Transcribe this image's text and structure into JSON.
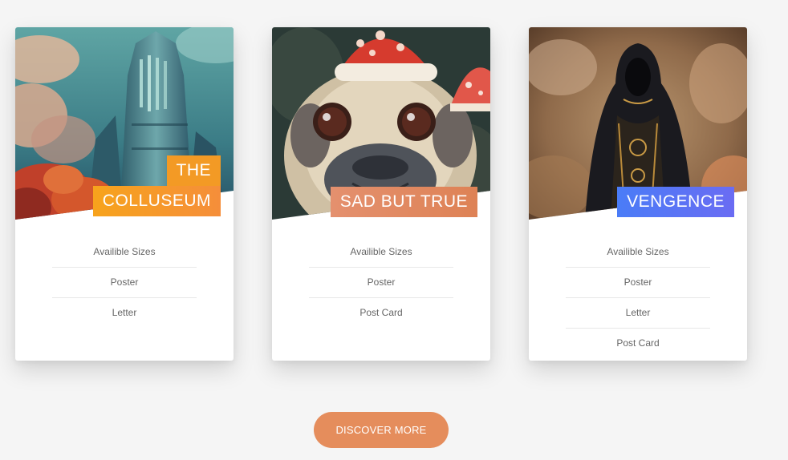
{
  "cards": [
    {
      "title_lines": [
        "THE",
        "COLLUSEUM"
      ],
      "image_subject": "gothic tower with autumn trees",
      "sizes_heading": "Availible Sizes",
      "sizes": [
        "Poster",
        "Letter"
      ],
      "accent": "#f39a25"
    },
    {
      "title_lines": [
        "SAD BUT TRUE"
      ],
      "image_subject": "pug with mushroom cap",
      "sizes_heading": "Availible Sizes",
      "sizes": [
        "Poster",
        "Post Card"
      ],
      "accent": "#e08a60"
    },
    {
      "title_lines": [
        "VENGENCE"
      ],
      "image_subject": "hooded dark figure",
      "sizes_heading": "Availible Sizes",
      "sizes": [
        "Poster",
        "Letter",
        "Post Card"
      ],
      "accent": "#5a74f5"
    }
  ],
  "discover_button": {
    "label": "DISCOVER MORE",
    "color": "#e58d5c"
  }
}
